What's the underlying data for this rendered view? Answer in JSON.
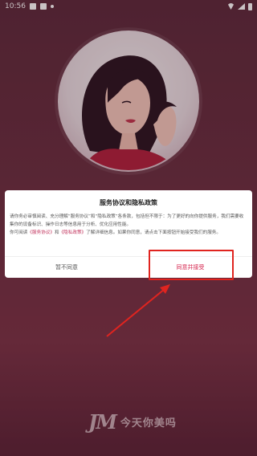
{
  "status_bar": {
    "time": "10:56",
    "left_icons": [
      "mail-icon",
      "image-icon",
      "notification-dot-icon"
    ],
    "right_icons": [
      "wifi-icon",
      "signal-icon",
      "battery-icon"
    ]
  },
  "dialog": {
    "title": "服务协议和隐私政策",
    "body_line1": "请你务必审慎阅读、充分理解“服务协议”和“隐私政策”各条款，包括但不限于：为了更好的向你提供服务，我们需要收集你的设备标识、操作日志等信息用于分析、优化应用性能。",
    "body_prefix": "你可阅读",
    "link_service": "《服务协议》",
    "body_and": "和",
    "link_privacy": "《隐私政策》",
    "body_suffix": "了解详细信息。如果你同意，请点击下面按钮开始接受我们的服务。",
    "reject_label": "暂不同意",
    "accept_label": "同意并接受"
  },
  "brand": {
    "logo": "JM",
    "name": "今天你美吗"
  },
  "colors": {
    "accent": "#d5244d",
    "annotation": "#e0241f",
    "background": "#6a2f40"
  }
}
